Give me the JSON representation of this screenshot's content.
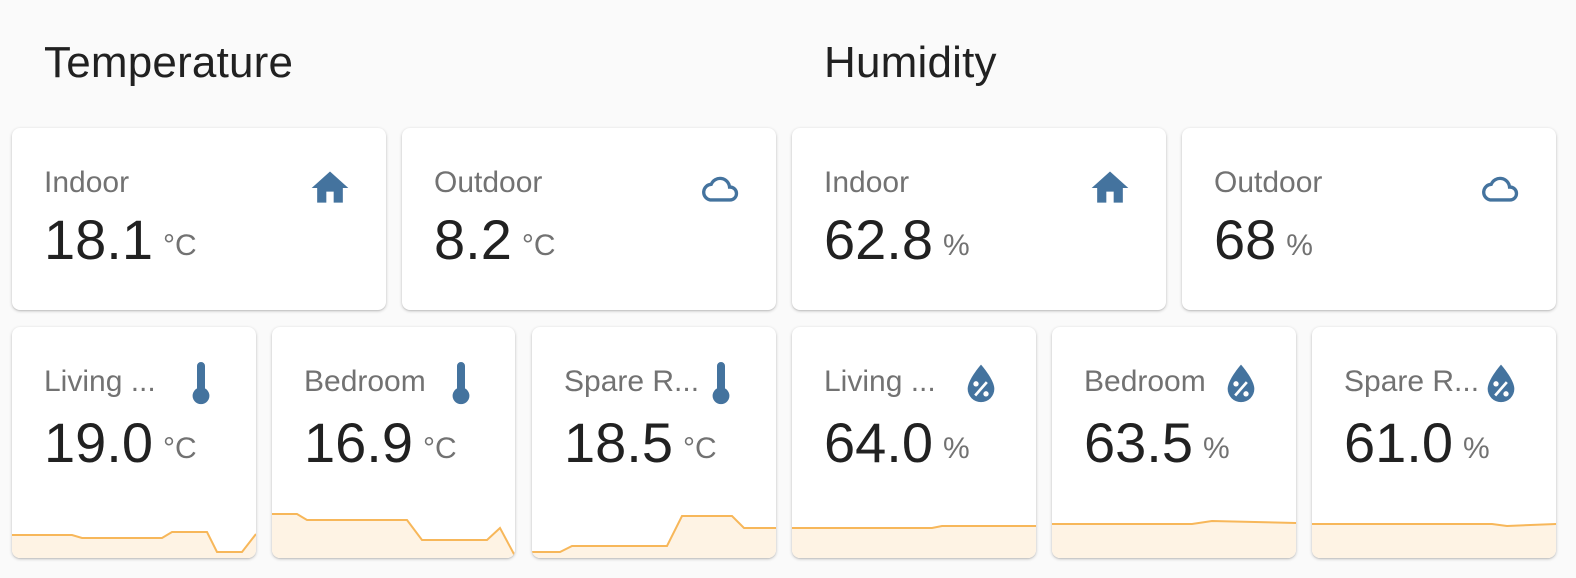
{
  "colors": {
    "accent": "#44739e",
    "sparkline": "#f7b75a",
    "sparkline_fill": "#fef3e4"
  },
  "temperature": {
    "title": "Temperature",
    "indoor": {
      "name": "Indoor",
      "value": "18.1",
      "unit": "°C",
      "icon": "home-icon"
    },
    "outdoor": {
      "name": "Outdoor",
      "value": "8.2",
      "unit": "°C",
      "icon": "cloud-icon"
    },
    "rooms": [
      {
        "name": "Living ...",
        "value": "19.0",
        "unit": "°C",
        "icon": "thermometer-icon"
      },
      {
        "name": "Bedroom",
        "value": "16.9",
        "unit": "°C",
        "icon": "thermometer-icon"
      },
      {
        "name": "Spare R...",
        "value": "18.5",
        "unit": "°C",
        "icon": "thermometer-icon"
      }
    ]
  },
  "humidity": {
    "title": "Humidity",
    "indoor": {
      "name": "Indoor",
      "value": "62.8",
      "unit": "%",
      "icon": "home-icon"
    },
    "outdoor": {
      "name": "Outdoor",
      "value": "68",
      "unit": "%",
      "icon": "cloud-icon"
    },
    "rooms": [
      {
        "name": "Living ...",
        "value": "64.0",
        "unit": "%",
        "icon": "water-percent-icon"
      },
      {
        "name": "Bedroom",
        "value": "63.5",
        "unit": "%",
        "icon": "water-percent-icon"
      },
      {
        "name": "Spare R...",
        "value": "61.0",
        "unit": "%",
        "icon": "water-percent-icon"
      }
    ]
  }
}
